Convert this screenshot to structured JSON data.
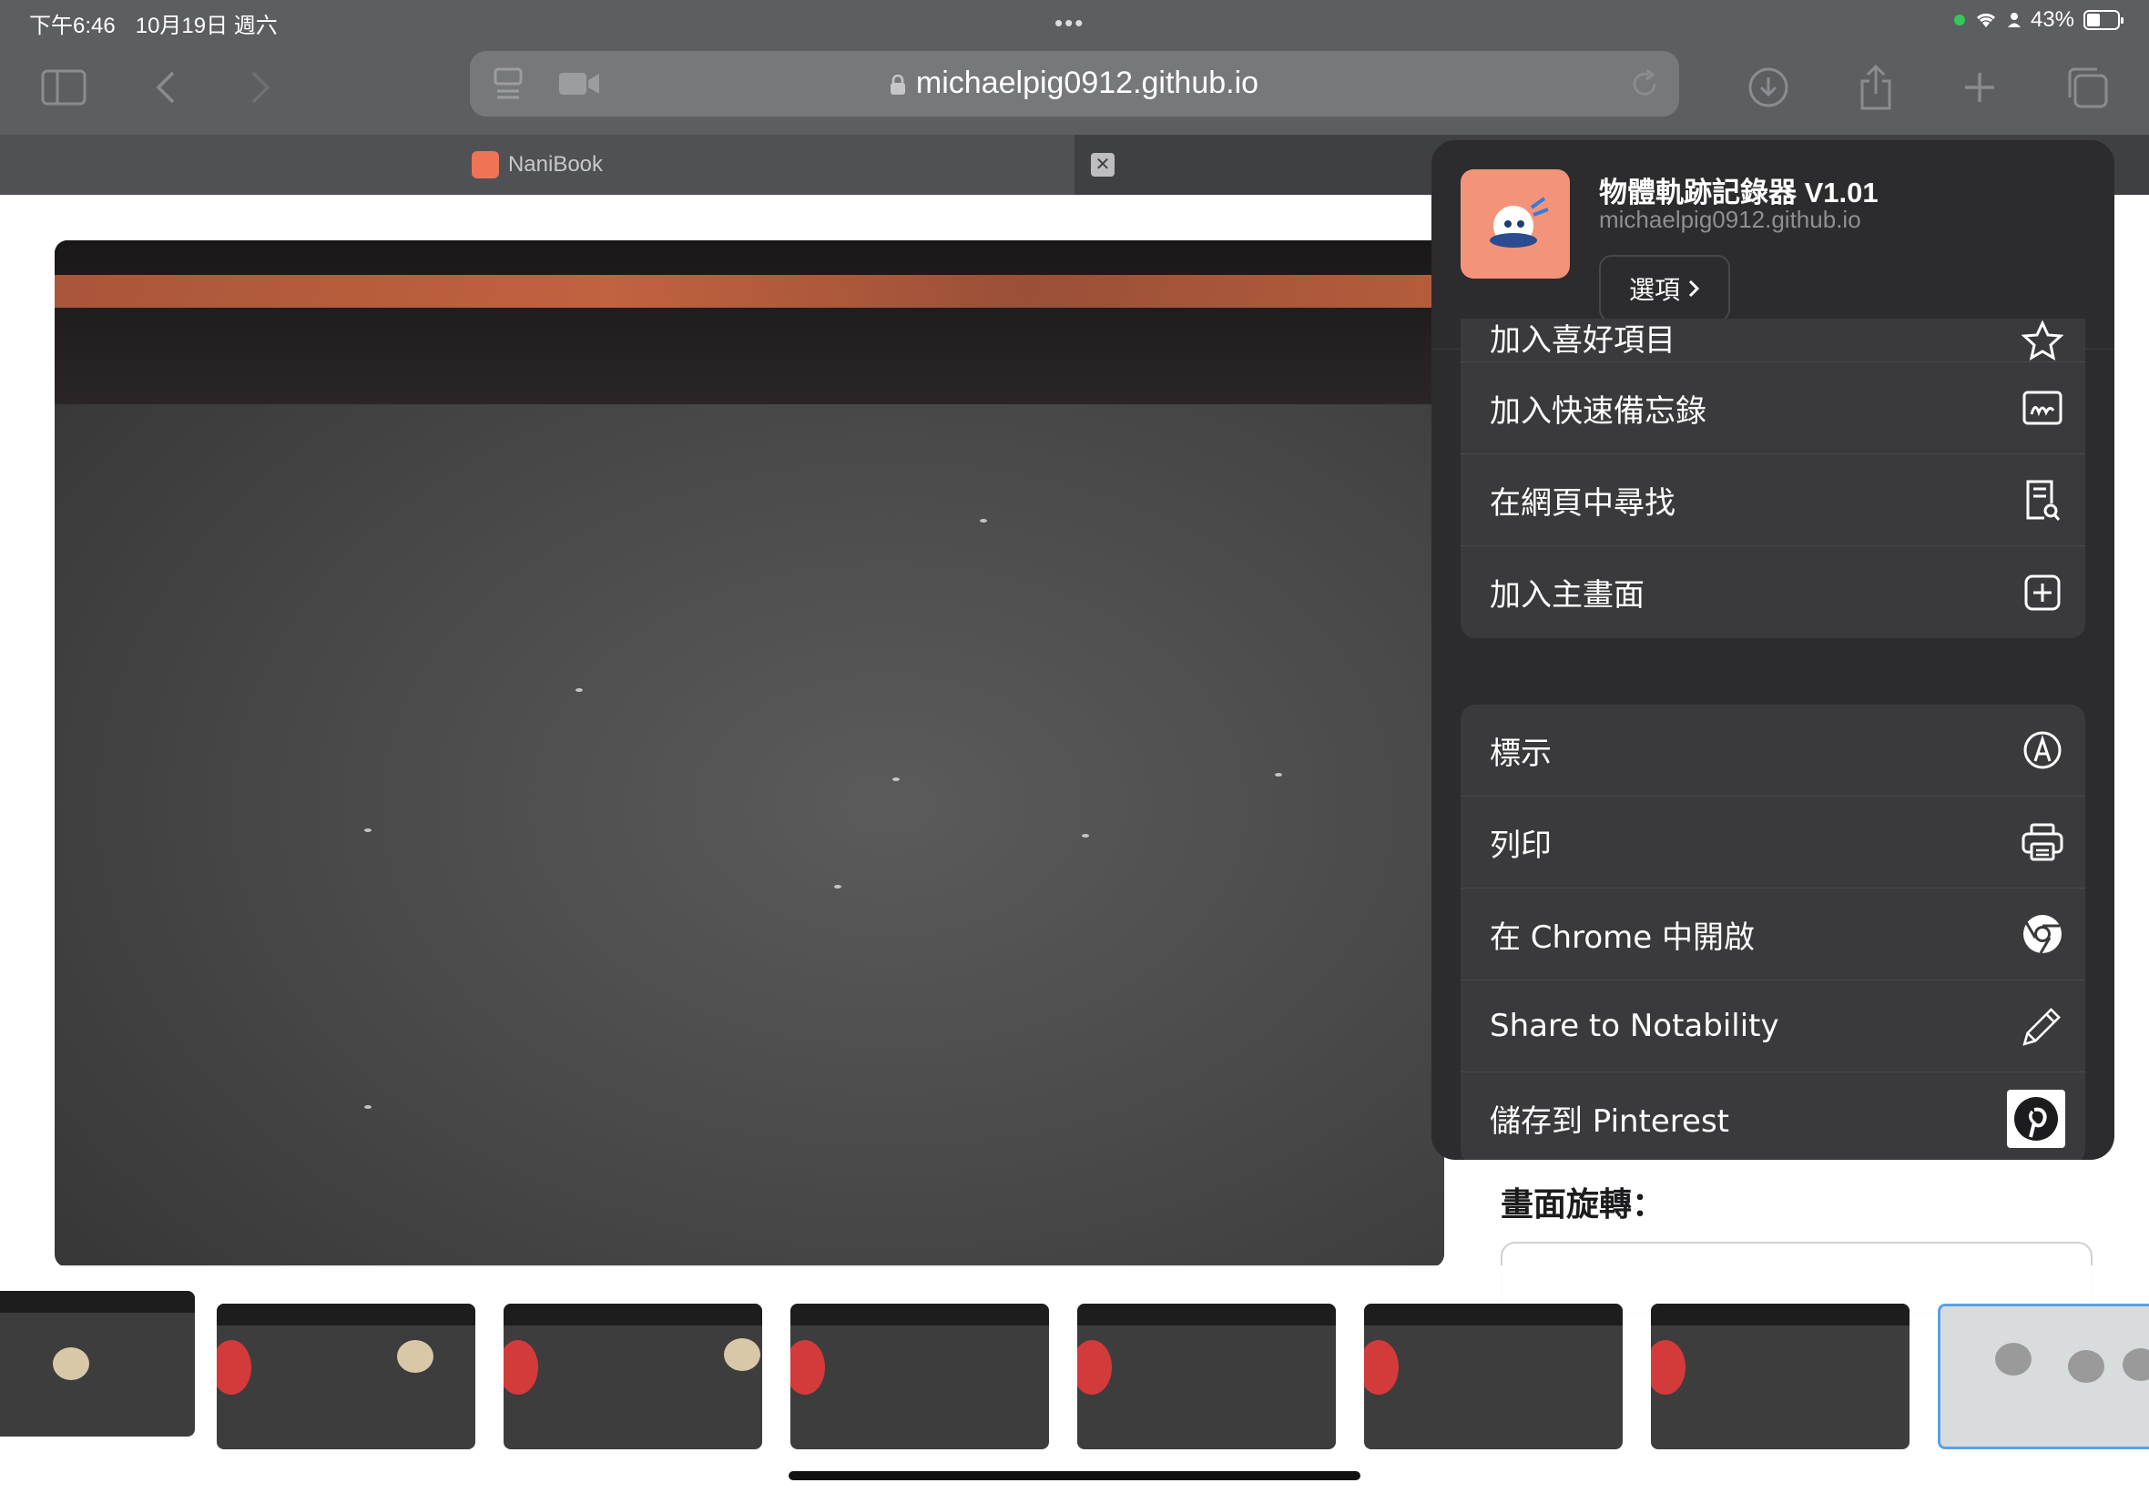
{
  "status": {
    "time": "下午6:46",
    "date": "10月19日 週六",
    "battery": "43%"
  },
  "toolbar": {
    "url": "michaelpig0912.github.io"
  },
  "tabs": [
    {
      "label": "NaniBook"
    }
  ],
  "share": {
    "title": "物體軌跡記錄器 V1.01",
    "domain": "michaelpig0912.github.io",
    "options_label": "選項",
    "group1": [
      {
        "label": "加入喜好項目",
        "icon": "star-icon"
      },
      {
        "label": "加入快速備忘錄",
        "icon": "quick-note-icon"
      },
      {
        "label": "在網頁中尋找",
        "icon": "find-in-page-icon"
      },
      {
        "label": "加入主畫面",
        "icon": "add-square-icon"
      }
    ],
    "group2": [
      {
        "label": "標示",
        "icon": "markup-icon"
      },
      {
        "label": "列印",
        "icon": "printer-icon"
      },
      {
        "label": "在 Chrome 中開啟",
        "icon": "chrome-icon"
      },
      {
        "label": "Share to Notability",
        "icon": "pencil-icon"
      },
      {
        "label": "儲存到 Pinterest",
        "icon": "pinterest-icon"
      }
    ]
  },
  "page": {
    "rotation_title": "畫面旋轉："
  },
  "colors": {
    "toolbar": "#5d5e62",
    "sheet": "#2c2c2e",
    "row": "#3a3a3c",
    "app_icon": "#f3937a",
    "selected_thumb": "#5aa0e8"
  }
}
